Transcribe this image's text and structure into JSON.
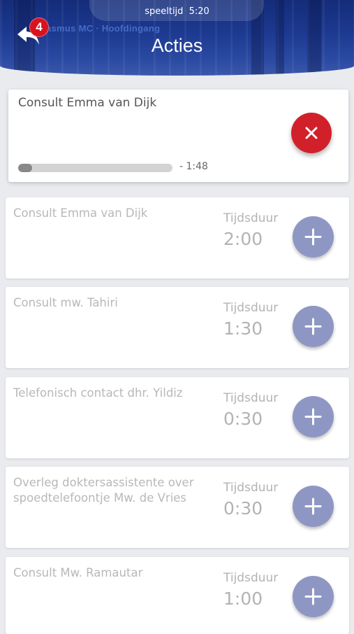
{
  "header": {
    "timer_label": "speeltijd",
    "timer_value": "5:20",
    "title": "Acties",
    "sign_text": "asmus MC · Hoofdingang",
    "notification_count": "4"
  },
  "active_action": {
    "name": "Consult Emma van Dijk",
    "progress": 0.08,
    "remaining": "- 1:48"
  },
  "actions": [
    {
      "name": "Consult Emma van Dijk",
      "duration_label": "Tijdsduur",
      "duration": "2:00"
    },
    {
      "name": "Consult  mw. Tahiri",
      "duration_label": "Tijdsduur",
      "duration": "1:30"
    },
    {
      "name": "Telefonisch contact dhr. Yildiz",
      "duration_label": "Tijdsduur",
      "duration": "0:30"
    },
    {
      "name": "Overleg doktersassistente over spoedtelefoontje Mw. de Vries",
      "duration_label": "Tijdsduur",
      "duration": "0:30"
    },
    {
      "name": "Consult Mw. Ramautar",
      "duration_label": "Tijdsduur",
      "duration": "1:00"
    }
  ],
  "colors": {
    "header": "#1d3a91",
    "cancel": "#d2202a",
    "add": "#8e97c4",
    "badge": "#d8121f"
  },
  "icons": {
    "back": "reply-arrow-icon",
    "cancel": "close-icon",
    "add": "plus-icon"
  }
}
